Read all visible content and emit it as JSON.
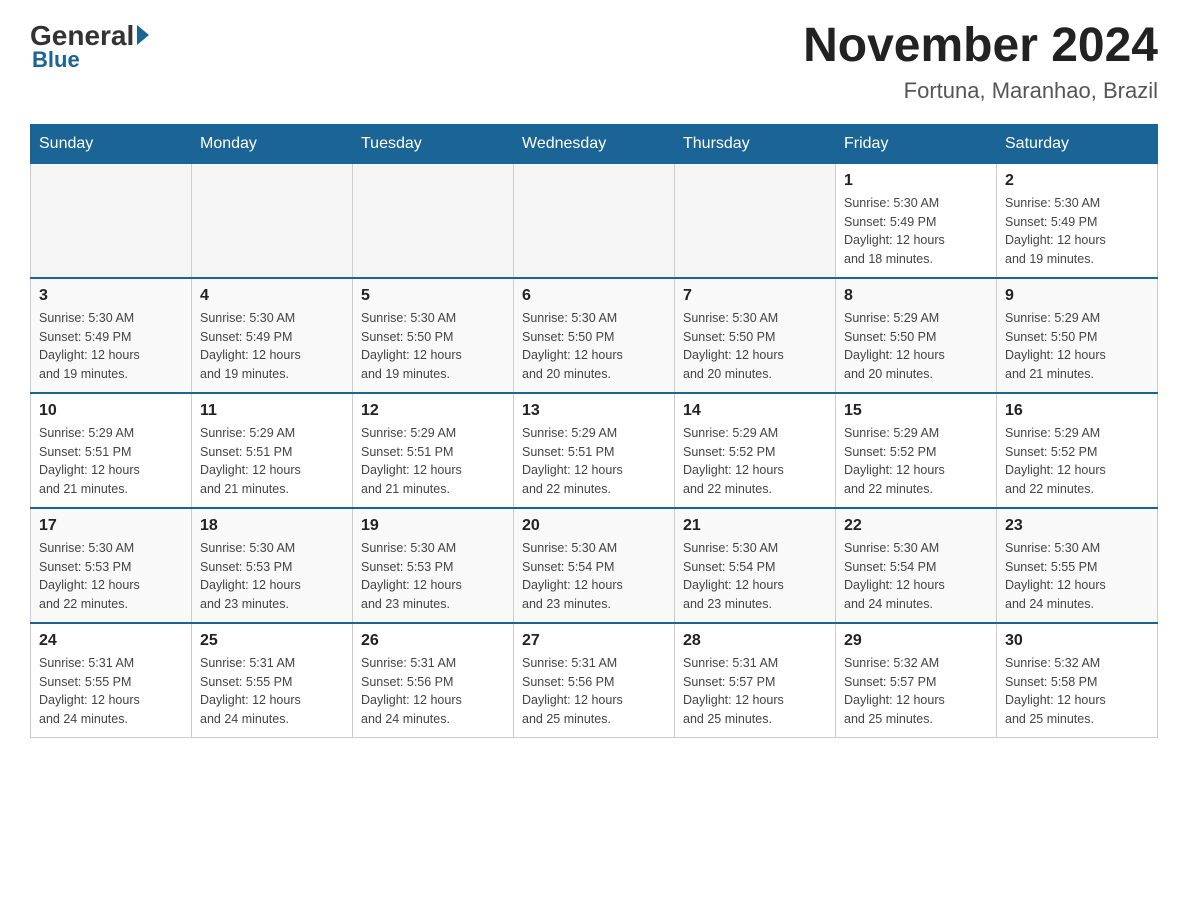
{
  "logo": {
    "part1": "General",
    "part2": "Blue"
  },
  "title": "November 2024",
  "location": "Fortuna, Maranhao, Brazil",
  "days_of_week": [
    "Sunday",
    "Monday",
    "Tuesday",
    "Wednesday",
    "Thursday",
    "Friday",
    "Saturday"
  ],
  "weeks": [
    [
      {
        "day": "",
        "info": ""
      },
      {
        "day": "",
        "info": ""
      },
      {
        "day": "",
        "info": ""
      },
      {
        "day": "",
        "info": ""
      },
      {
        "day": "",
        "info": ""
      },
      {
        "day": "1",
        "info": "Sunrise: 5:30 AM\nSunset: 5:49 PM\nDaylight: 12 hours\nand 18 minutes."
      },
      {
        "day": "2",
        "info": "Sunrise: 5:30 AM\nSunset: 5:49 PM\nDaylight: 12 hours\nand 19 minutes."
      }
    ],
    [
      {
        "day": "3",
        "info": "Sunrise: 5:30 AM\nSunset: 5:49 PM\nDaylight: 12 hours\nand 19 minutes."
      },
      {
        "day": "4",
        "info": "Sunrise: 5:30 AM\nSunset: 5:49 PM\nDaylight: 12 hours\nand 19 minutes."
      },
      {
        "day": "5",
        "info": "Sunrise: 5:30 AM\nSunset: 5:50 PM\nDaylight: 12 hours\nand 19 minutes."
      },
      {
        "day": "6",
        "info": "Sunrise: 5:30 AM\nSunset: 5:50 PM\nDaylight: 12 hours\nand 20 minutes."
      },
      {
        "day": "7",
        "info": "Sunrise: 5:30 AM\nSunset: 5:50 PM\nDaylight: 12 hours\nand 20 minutes."
      },
      {
        "day": "8",
        "info": "Sunrise: 5:29 AM\nSunset: 5:50 PM\nDaylight: 12 hours\nand 20 minutes."
      },
      {
        "day": "9",
        "info": "Sunrise: 5:29 AM\nSunset: 5:50 PM\nDaylight: 12 hours\nand 21 minutes."
      }
    ],
    [
      {
        "day": "10",
        "info": "Sunrise: 5:29 AM\nSunset: 5:51 PM\nDaylight: 12 hours\nand 21 minutes."
      },
      {
        "day": "11",
        "info": "Sunrise: 5:29 AM\nSunset: 5:51 PM\nDaylight: 12 hours\nand 21 minutes."
      },
      {
        "day": "12",
        "info": "Sunrise: 5:29 AM\nSunset: 5:51 PM\nDaylight: 12 hours\nand 21 minutes."
      },
      {
        "day": "13",
        "info": "Sunrise: 5:29 AM\nSunset: 5:51 PM\nDaylight: 12 hours\nand 22 minutes."
      },
      {
        "day": "14",
        "info": "Sunrise: 5:29 AM\nSunset: 5:52 PM\nDaylight: 12 hours\nand 22 minutes."
      },
      {
        "day": "15",
        "info": "Sunrise: 5:29 AM\nSunset: 5:52 PM\nDaylight: 12 hours\nand 22 minutes."
      },
      {
        "day": "16",
        "info": "Sunrise: 5:29 AM\nSunset: 5:52 PM\nDaylight: 12 hours\nand 22 minutes."
      }
    ],
    [
      {
        "day": "17",
        "info": "Sunrise: 5:30 AM\nSunset: 5:53 PM\nDaylight: 12 hours\nand 22 minutes."
      },
      {
        "day": "18",
        "info": "Sunrise: 5:30 AM\nSunset: 5:53 PM\nDaylight: 12 hours\nand 23 minutes."
      },
      {
        "day": "19",
        "info": "Sunrise: 5:30 AM\nSunset: 5:53 PM\nDaylight: 12 hours\nand 23 minutes."
      },
      {
        "day": "20",
        "info": "Sunrise: 5:30 AM\nSunset: 5:54 PM\nDaylight: 12 hours\nand 23 minutes."
      },
      {
        "day": "21",
        "info": "Sunrise: 5:30 AM\nSunset: 5:54 PM\nDaylight: 12 hours\nand 23 minutes."
      },
      {
        "day": "22",
        "info": "Sunrise: 5:30 AM\nSunset: 5:54 PM\nDaylight: 12 hours\nand 24 minutes."
      },
      {
        "day": "23",
        "info": "Sunrise: 5:30 AM\nSunset: 5:55 PM\nDaylight: 12 hours\nand 24 minutes."
      }
    ],
    [
      {
        "day": "24",
        "info": "Sunrise: 5:31 AM\nSunset: 5:55 PM\nDaylight: 12 hours\nand 24 minutes."
      },
      {
        "day": "25",
        "info": "Sunrise: 5:31 AM\nSunset: 5:55 PM\nDaylight: 12 hours\nand 24 minutes."
      },
      {
        "day": "26",
        "info": "Sunrise: 5:31 AM\nSunset: 5:56 PM\nDaylight: 12 hours\nand 24 minutes."
      },
      {
        "day": "27",
        "info": "Sunrise: 5:31 AM\nSunset: 5:56 PM\nDaylight: 12 hours\nand 25 minutes."
      },
      {
        "day": "28",
        "info": "Sunrise: 5:31 AM\nSunset: 5:57 PM\nDaylight: 12 hours\nand 25 minutes."
      },
      {
        "day": "29",
        "info": "Sunrise: 5:32 AM\nSunset: 5:57 PM\nDaylight: 12 hours\nand 25 minutes."
      },
      {
        "day": "30",
        "info": "Sunrise: 5:32 AM\nSunset: 5:58 PM\nDaylight: 12 hours\nand 25 minutes."
      }
    ]
  ]
}
